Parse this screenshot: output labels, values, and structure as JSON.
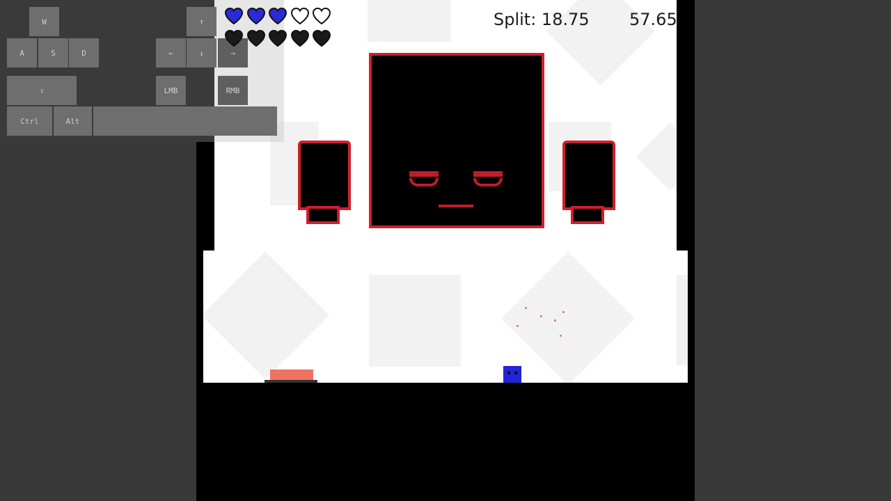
{
  "hud": {
    "split_label": "Split: 18.75",
    "total_time": "57.65"
  },
  "keys": {
    "w": "W",
    "a": "A",
    "s": "S",
    "d": "D",
    "up": "↑",
    "left": "←",
    "down": "↓",
    "right": "→",
    "shift": "⇧",
    "lmb": "LMB",
    "rmb": "RMB",
    "ctrl": "Ctrl",
    "alt": "Alt",
    "space": ""
  },
  "health": {
    "player_hearts": 5,
    "player_filled": 3,
    "boss_hearts": 5,
    "boss_filled": 5,
    "player_color": "#2b2bd6",
    "boss_color": "#1a1a1a"
  },
  "colors": {
    "boss_outline": "#d01e2c",
    "player": "#2323d9",
    "jump_pad": "#ef7263"
  }
}
